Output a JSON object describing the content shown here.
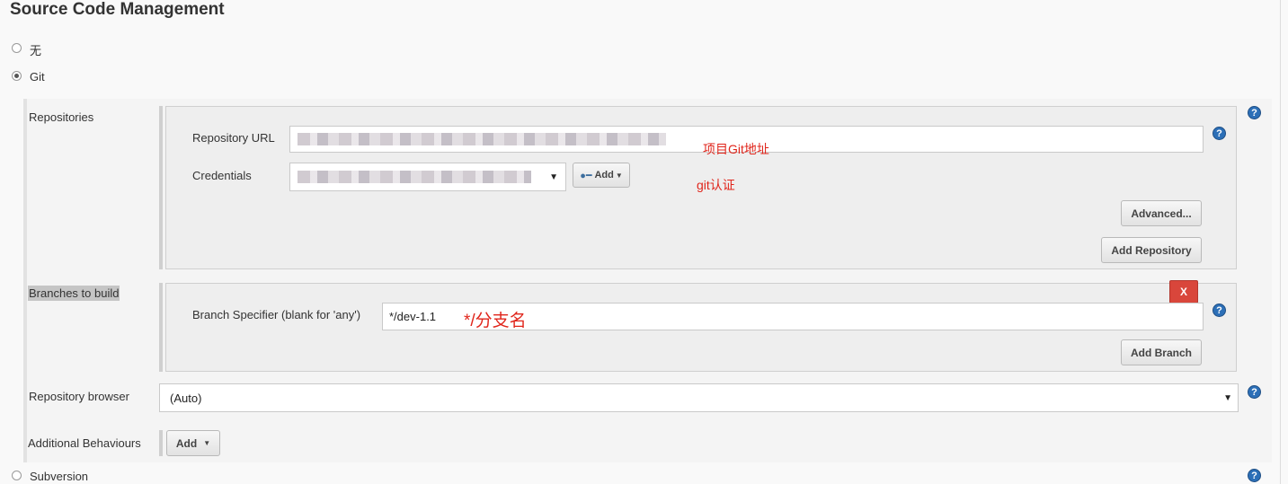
{
  "section": {
    "title": "Source Code Management"
  },
  "scm_options": [
    {
      "label": "无",
      "selected": false
    },
    {
      "label": "Git",
      "selected": true
    },
    {
      "label": "Subversion",
      "selected": false
    }
  ],
  "repositories": {
    "label": "Repositories",
    "url_label": "Repository URL",
    "url_annotation": "项目Git地址",
    "credentials_label": "Credentials",
    "credentials_annotation": "git认证",
    "credentials_add_label": "Add",
    "advanced_label": "Advanced...",
    "add_repository_label": "Add Repository"
  },
  "branches": {
    "label": "Branches to build",
    "delete_label": "X",
    "specifier_label": "Branch Specifier (blank for 'any')",
    "specifier_value": "*/dev-1.1",
    "specifier_annotation": "*/分支名",
    "add_branch_label": "Add Branch"
  },
  "repo_browser": {
    "label": "Repository browser",
    "value": "(Auto)"
  },
  "additional": {
    "label": "Additional Behaviours",
    "add_label": "Add"
  },
  "icons": {
    "help": "help-icon",
    "key": "key-icon",
    "dropdown": "chevron-down-icon"
  },
  "colors": {
    "help": "#2c6fb7",
    "annotation": "#e0251b",
    "delete": "#d9463b"
  }
}
